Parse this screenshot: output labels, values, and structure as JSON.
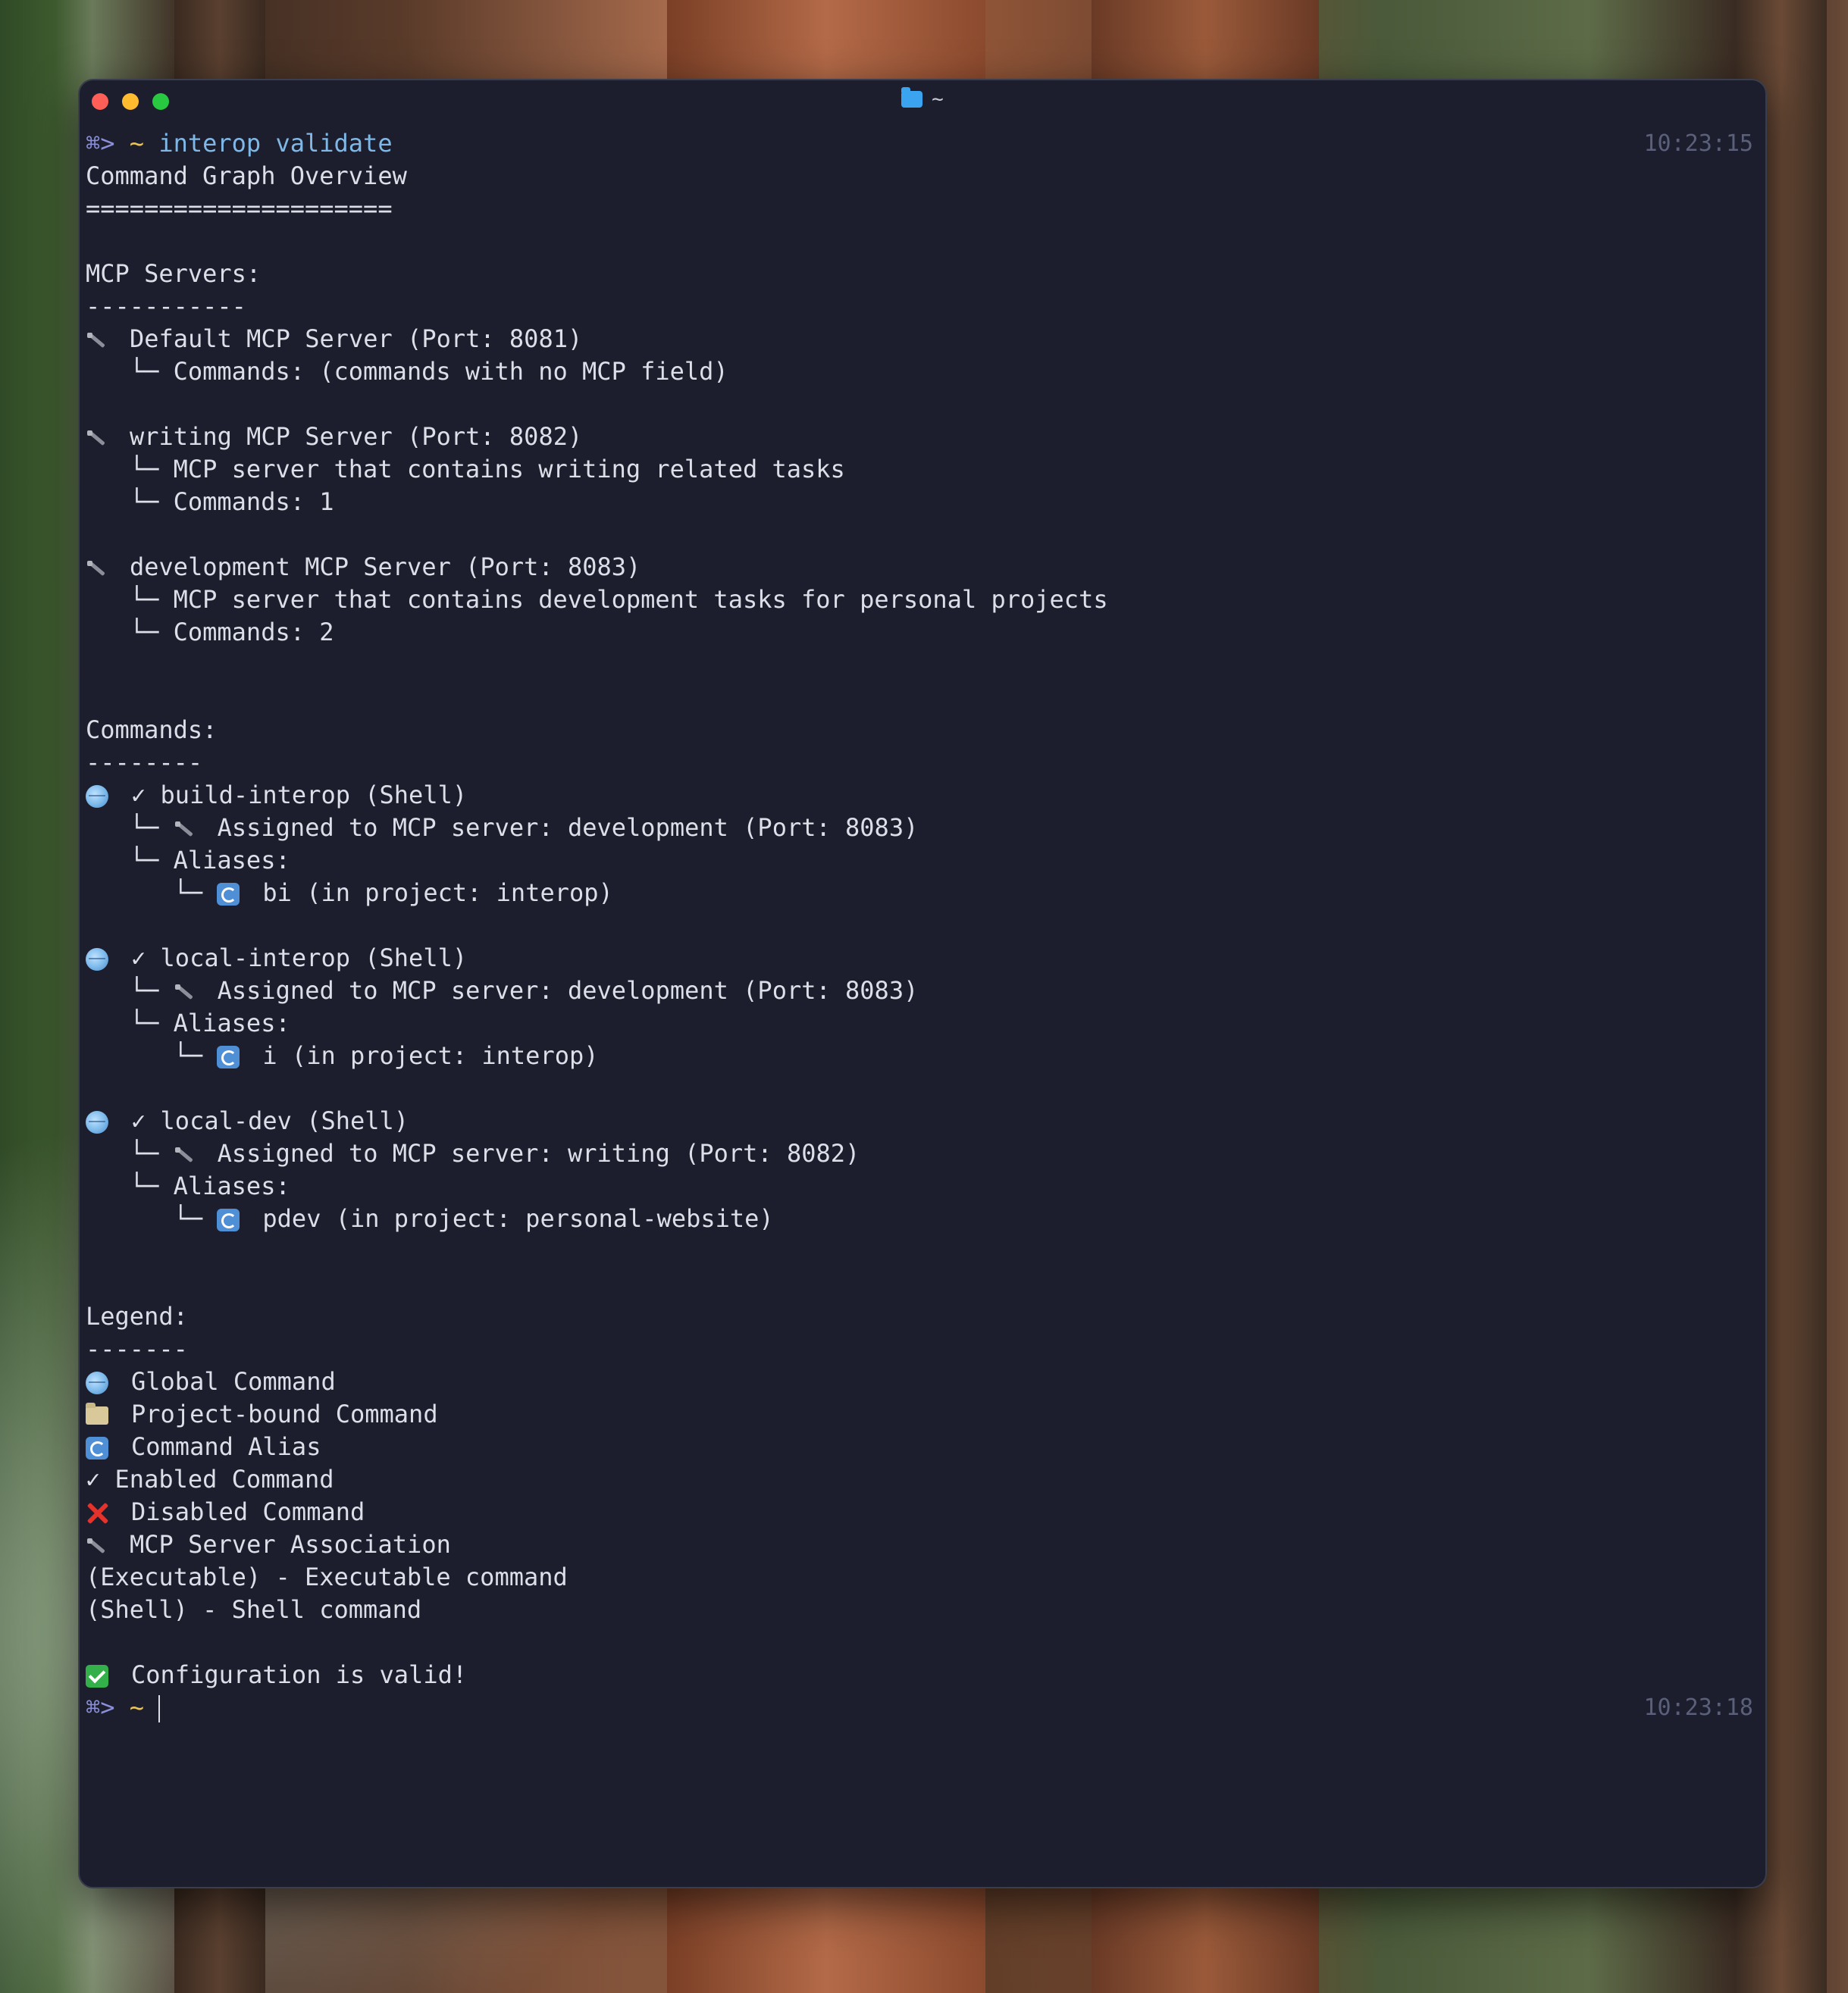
{
  "window": {
    "title": "~"
  },
  "terminal": {
    "prompt_symbol": "⌘>",
    "prompt_dir": "~",
    "command": "interop validate",
    "timestamp_start": "10:23:15",
    "timestamp_end": "10:23:18",
    "heading": "Command Graph Overview",
    "heading_rule": "=====================",
    "mcp_section": "MCP Servers:",
    "mcp_rule": "-----------",
    "servers": [
      {
        "title": "Default MCP Server (Port: 8081)",
        "details": [
          "Commands: (commands with no MCP field)"
        ]
      },
      {
        "title": "writing MCP Server (Port: 8082)",
        "details": [
          "MCP server that contains writing related tasks",
          "Commands: 1"
        ]
      },
      {
        "title": "development MCP Server (Port: 8083)",
        "details": [
          "MCP server that contains development tasks for personal projects",
          "Commands: 2"
        ]
      }
    ],
    "commands_section": "Commands:",
    "commands_rule": "--------",
    "commands": [
      {
        "name": "✓ build-interop (Shell)",
        "assigned": "Assigned to MCP server: development (Port: 8083)",
        "aliases_label": "Aliases:",
        "alias": "bi (in project: interop)"
      },
      {
        "name": "✓ local-interop (Shell)",
        "assigned": "Assigned to MCP server: development (Port: 8083)",
        "aliases_label": "Aliases:",
        "alias": "i (in project: interop)"
      },
      {
        "name": "✓ local-dev (Shell)",
        "assigned": "Assigned to MCP server: writing (Port: 8082)",
        "aliases_label": "Aliases:",
        "alias": "pdev (in project: personal-website)"
      }
    ],
    "legend_section": "Legend:",
    "legend_rule": "-------",
    "legend": {
      "global": "Global Command",
      "project": "Project-bound Command",
      "alias": "Command Alias",
      "enabled": "✓ Enabled Command",
      "disabled": "Disabled Command",
      "mcp": "MCP Server Association",
      "executable": "(Executable) - Executable command",
      "shell": "(Shell) - Shell command"
    },
    "result": "Configuration is valid!",
    "tree_branch": "└─"
  },
  "icons": [
    "folder-icon",
    "plug-icon",
    "globe-icon",
    "cycle-icon",
    "x-icon",
    "checkbox-icon"
  ]
}
